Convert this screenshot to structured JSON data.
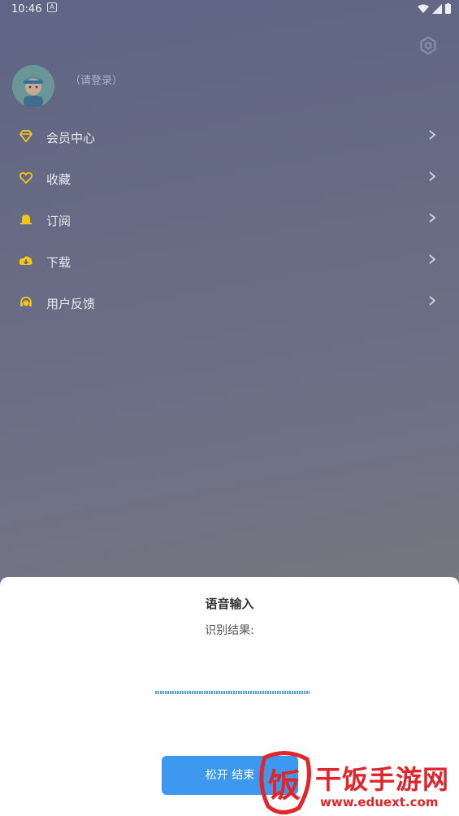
{
  "status_bar": {
    "time": "10:46",
    "a_icon": "A"
  },
  "header": {
    "settings_icon": "gear-icon"
  },
  "profile": {
    "login_text": "（请登录）"
  },
  "menu": {
    "items": [
      {
        "label": "会员中心",
        "icon": "diamond-icon"
      },
      {
        "label": "收藏",
        "icon": "heart-icon"
      },
      {
        "label": "订阅",
        "icon": "bell-icon"
      },
      {
        "label": "下载",
        "icon": "download-icon"
      },
      {
        "label": "用户反馈",
        "icon": "headset-icon"
      }
    ]
  },
  "voice_sheet": {
    "title": "语音输入",
    "result_label": "识别结果:",
    "release_button": "松开 结束"
  },
  "watermark": {
    "name": "干饭手游网",
    "url": "www.eduext.com",
    "logo_char": "饭"
  },
  "colors": {
    "accent": "#3d99ef",
    "menu_icon": "#f5c518",
    "watermark": "#e0262b"
  }
}
